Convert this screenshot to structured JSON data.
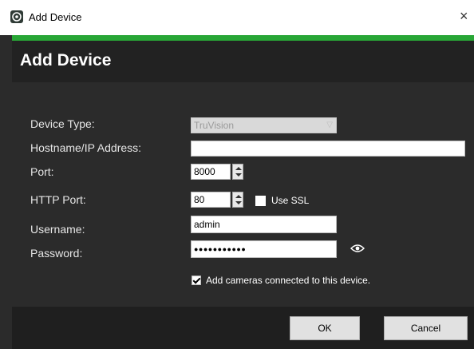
{
  "window": {
    "title": "Add Device",
    "close_glyph": "×",
    "accent_color": "#28a636"
  },
  "dialog": {
    "heading": "Add Device",
    "fields": {
      "device_type": {
        "label": "Device Type:",
        "value": "TruVision"
      },
      "hostname": {
        "label": "Hostname/IP Address:",
        "value": ""
      },
      "port": {
        "label": "Port:",
        "value": "8000"
      },
      "http_port": {
        "label": "HTTP Port:",
        "value": "80"
      },
      "username": {
        "label": "Username:",
        "value": "admin"
      },
      "password": {
        "label": "Password:",
        "value": "●●●●●●●●●●●"
      }
    },
    "use_ssl": {
      "label": "Use SSL",
      "checked": false
    },
    "add_cameras": {
      "label": "Add cameras connected to this device.",
      "checked": true
    },
    "buttons": {
      "ok": "OK",
      "cancel": "Cancel"
    }
  }
}
